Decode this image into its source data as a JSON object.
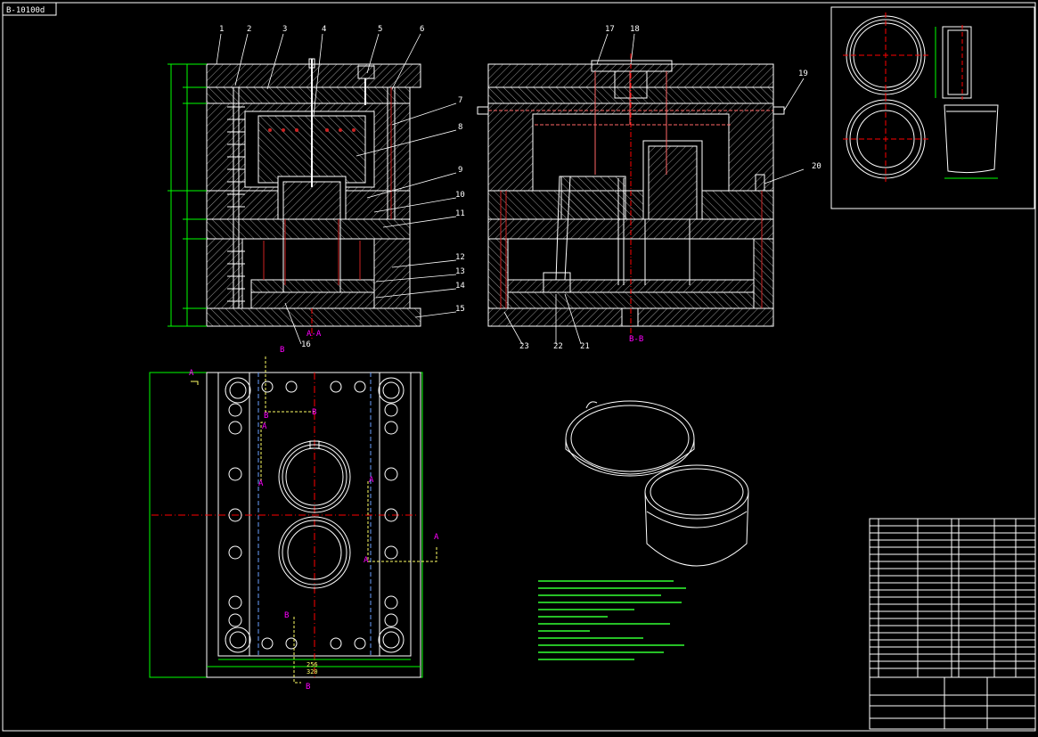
{
  "drawing": {
    "code": "B-10100d",
    "section_aa_label": "A-A",
    "section_bb_label": "B-B"
  },
  "callouts_left": [
    "1",
    "2",
    "3",
    "4",
    "5",
    "6",
    "7",
    "8",
    "9",
    "10",
    "11",
    "12",
    "13",
    "14",
    "15",
    "16"
  ],
  "callouts_right": [
    "17",
    "18",
    "19",
    "20",
    "21",
    "22",
    "23"
  ],
  "plan_markers": {
    "a": "A",
    "b": "B"
  },
  "dimension_labels": {
    "bottom_1": "256",
    "bottom_2": "320"
  },
  "colors": {
    "line": "#ffffff",
    "section_hatch": "#ffffff",
    "cut_plane": "#ff00ff",
    "centerline": "#ff0000",
    "dimension": "#00ff00",
    "hidden": "#00a0ff",
    "pin_red": "#cc2222",
    "label": "#ff00ff",
    "dim_text": "#ffff00",
    "tech_notes": "#33ff33"
  }
}
